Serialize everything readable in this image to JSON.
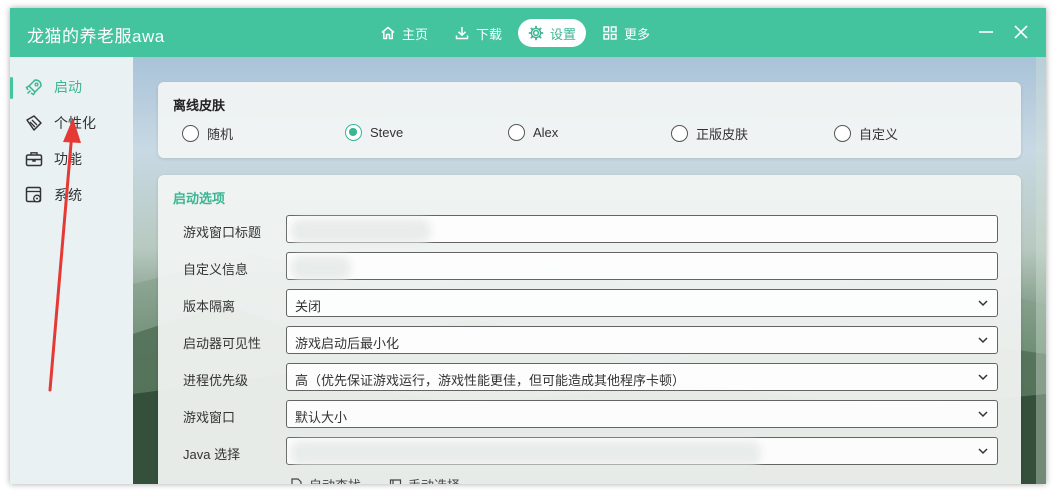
{
  "app": {
    "title": "龙猫的养老服awa"
  },
  "nav": {
    "items": [
      {
        "label": "主页",
        "icon": "home-icon",
        "active": false
      },
      {
        "label": "下载",
        "icon": "download-icon",
        "active": false
      },
      {
        "label": "设置",
        "icon": "gear-icon",
        "active": true
      },
      {
        "label": "更多",
        "icon": "grid-icon",
        "active": false
      }
    ]
  },
  "window_controls": {
    "minimize": "minimize-icon",
    "close": "close-icon"
  },
  "sidebar": {
    "items": [
      {
        "label": "启动",
        "icon": "rocket-icon",
        "active": true
      },
      {
        "label": "个性化",
        "icon": "brush-icon",
        "active": false
      },
      {
        "label": "功能",
        "icon": "briefcase-icon",
        "active": false
      },
      {
        "label": "系统",
        "icon": "settings-window-icon",
        "active": false
      }
    ]
  },
  "offline_skin": {
    "title": "离线皮肤",
    "options": [
      "随机",
      "Steve",
      "Alex",
      "正版皮肤",
      "自定义"
    ],
    "selected": "Steve"
  },
  "launch_options": {
    "title": "启动选项",
    "rows": [
      {
        "label": "游戏窗口标题",
        "value": "",
        "type": "text"
      },
      {
        "label": "自定义信息",
        "value": "",
        "type": "text"
      },
      {
        "label": "版本隔离",
        "value": "关闭",
        "type": "select"
      },
      {
        "label": "启动器可见性",
        "value": "游戏启动后最小化",
        "type": "select"
      },
      {
        "label": "进程优先级",
        "value": "高（优先保证游戏运行，游戏性能更佳，但可能造成其他程序卡顿）",
        "type": "select"
      },
      {
        "label": "游戏窗口",
        "value": "默认大小",
        "type": "select"
      },
      {
        "label": "Java 选择",
        "value": "",
        "type": "select"
      }
    ],
    "java_actions": [
      "自动查找",
      "手动选择"
    ]
  },
  "colors": {
    "accent": "#44c39f",
    "accent_text": "#3bb592",
    "annotation_arrow": "#e53935"
  }
}
